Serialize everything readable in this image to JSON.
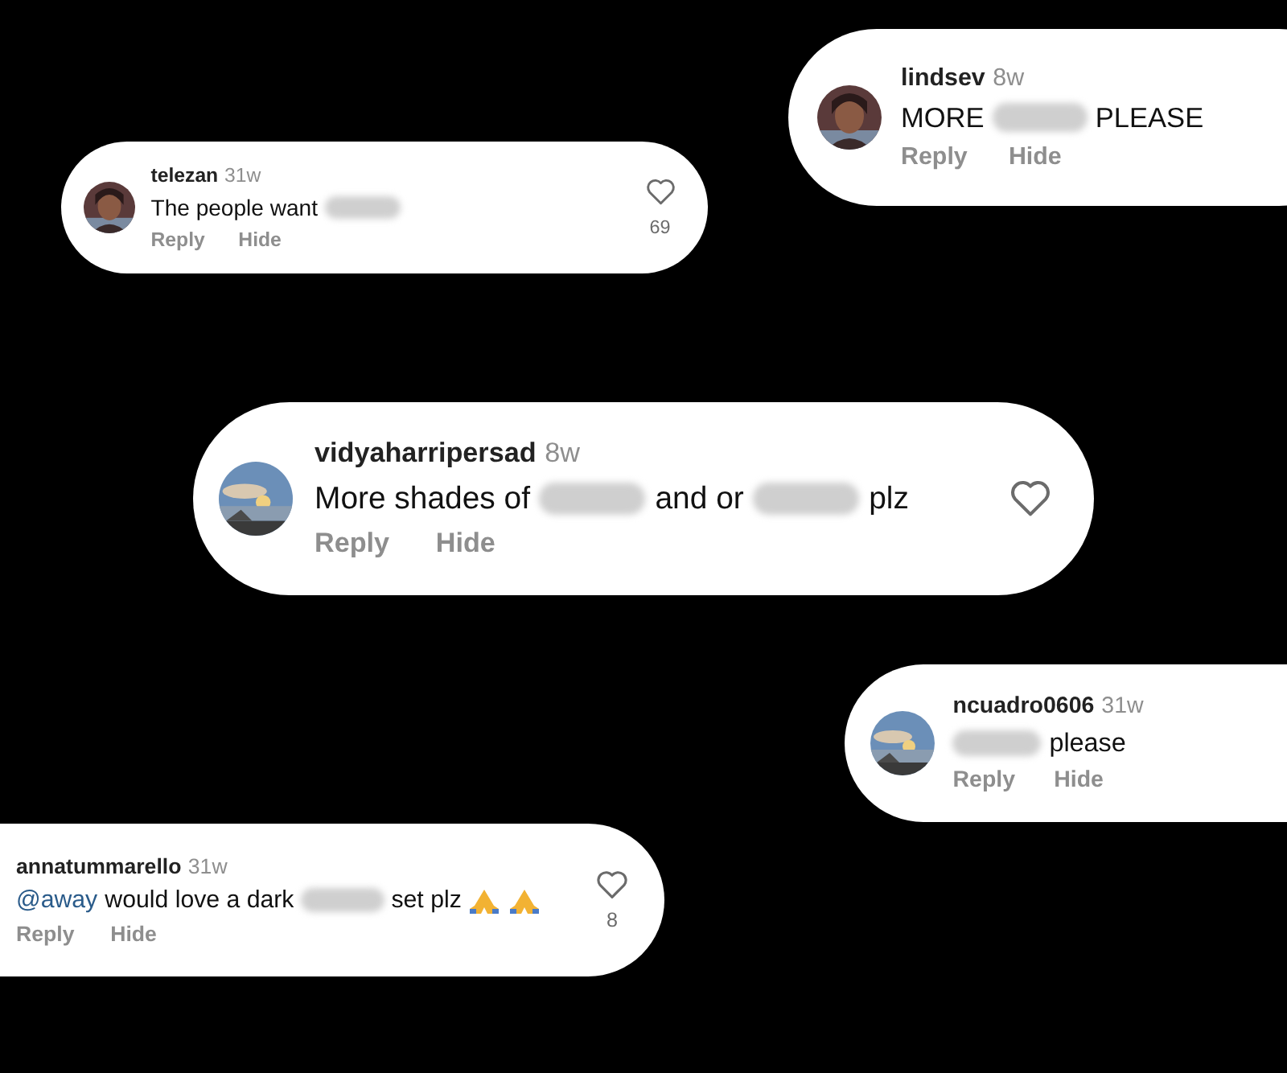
{
  "comments": [
    {
      "avatar": {
        "kind": "picture"
      },
      "username": "telezan",
      "age": "31w",
      "body": [
        {
          "kind": "text",
          "text": "The people want"
        },
        {
          "kind": "redacted"
        }
      ],
      "actions": [
        "Reply",
        "Hide"
      ],
      "heart": true,
      "likes": "69"
    },
    {
      "avatar": {
        "kind": "picture"
      },
      "username": "lindsev",
      "age": "8w",
      "body": [
        {
          "kind": "text",
          "text": "MORE"
        },
        {
          "kind": "redacted"
        },
        {
          "kind": "text",
          "text": "PLEASE"
        }
      ],
      "actions": [
        "Reply",
        "Hide"
      ],
      "heart": false
    },
    {
      "avatar": {
        "kind": "picture"
      },
      "username": "vidyaharripersad",
      "age": "8w",
      "body": [
        {
          "kind": "text",
          "text": "More shades of"
        },
        {
          "kind": "redacted"
        },
        {
          "kind": "text",
          "text": "and or"
        },
        {
          "kind": "redacted"
        },
        {
          "kind": "text",
          "text": "plz"
        }
      ],
      "actions": [
        "Reply",
        "Hide"
      ],
      "heart": true
    },
    {
      "avatar": {
        "kind": "picture"
      },
      "username": "ncuadro0606",
      "age": "31w",
      "body": [
        {
          "kind": "redacted"
        },
        {
          "kind": "text",
          "text": "please"
        }
      ],
      "actions": [
        "Reply",
        "Hide"
      ],
      "heart": false
    },
    {
      "username": "annatummarello",
      "age": "31w",
      "body": [
        {
          "kind": "mention",
          "text": "@away"
        },
        {
          "kind": "text",
          "text": "would love a dark"
        },
        {
          "kind": "redacted"
        },
        {
          "kind": "text",
          "text": "set plz"
        },
        {
          "kind": "prayer"
        },
        {
          "kind": "prayer"
        }
      ],
      "actions": [
        "Reply",
        "Hide"
      ],
      "heart": true,
      "likes": "8"
    }
  ]
}
